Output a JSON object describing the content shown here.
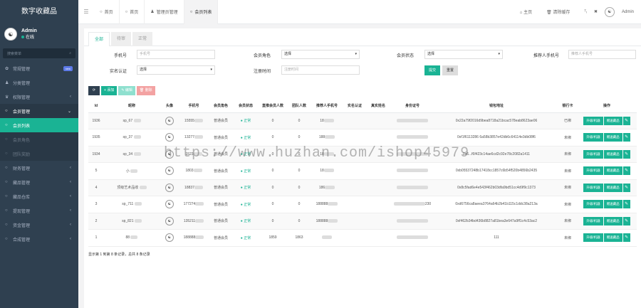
{
  "brand": "数字收藏品",
  "profile": {
    "name": "Admin",
    "status": "在线"
  },
  "sidebar": {
    "search_placeholder": "搜索菜单",
    "items": [
      {
        "icon": "dashboard-icon",
        "label": "常规管理",
        "badge": "new"
      },
      {
        "icon": "user-icon",
        "label": "分类管理"
      },
      {
        "icon": "group-icon",
        "label": "权限管理",
        "caret": "‹"
      },
      {
        "icon": "circle-icon",
        "label": "会员管理",
        "caret": "⌄",
        "open": true
      }
    ],
    "sub_items": [
      {
        "label": "会员列表",
        "active": true
      },
      {
        "label": "会员角色"
      },
      {
        "label": "团队奖励"
      }
    ],
    "items2": [
      {
        "label": "财务管理"
      },
      {
        "label": "藏品管理"
      },
      {
        "label": "藏品仓库"
      },
      {
        "label": "提现管理"
      },
      {
        "label": "资金管理"
      },
      {
        "label": "合成管理"
      }
    ]
  },
  "topbar": {
    "tabs": [
      {
        "icon": "○",
        "label": "首页"
      },
      {
        "icon": "○",
        "label": "首页"
      },
      {
        "icon": "♟",
        "label": "管理员管理"
      },
      {
        "icon": "○",
        "label": "会员列表",
        "active": true
      }
    ],
    "home": "主页",
    "clear_cache": "清除缓存",
    "user": "Admin"
  },
  "panel": {
    "tabs": [
      "全部",
      "待审",
      "正常"
    ],
    "filters": {
      "phone_label": "手机号",
      "phone_placeholder": "手机号",
      "role_label": "会员角色",
      "role_value": "选择",
      "status_label": "会员状态",
      "status_value": "选择",
      "referrer_label": "推荐人手机号",
      "referrer_placeholder": "推荐人手机号",
      "realname_label": "实名认证",
      "realname_value": "选择",
      "regtime_label": "注册时间",
      "regtime_placeholder": "注册时间",
      "submit": "提交",
      "reset": "重置"
    },
    "toolbar": {
      "refresh": "⟳",
      "add": "+ 添加",
      "edit": "✎ 编辑",
      "del": "🗑 删除"
    },
    "columns": [
      "Id",
      "昵称",
      "头像",
      "手机号",
      "会员角色",
      "会员状态",
      "直推会员人数",
      "团队人数",
      "推荐人手机号",
      "实名认证",
      "真实姓名",
      "身份证号",
      "钱包地址",
      "银行卡",
      "操作"
    ],
    "rows": [
      {
        "id": "1936",
        "nick": "sp_67",
        "phone": "15555",
        "role": "普通会员",
        "status": "● 正常",
        "direct": "0",
        "team": "0",
        "ref": "18",
        "wallet": "0x22a79f2016d9bea8718a21bcac578eab8623ae06",
        "bank": "已绑"
      },
      {
        "id": "1935",
        "nick": "sp_37",
        "phone": "13277",
        "role": "普通会员",
        "status": "● 正常",
        "direct": "0",
        "team": "0",
        "ref": "188",
        "wallet": "0xf1f6113286 6a58b3857e42db6c64114e3db08f6",
        "bank": "未绑"
      },
      {
        "id": "1934",
        "nick": "sp_34",
        "phone": "1523",
        "role": "普通会员",
        "status": "● 正常",
        "direct": "0",
        "team": "0",
        "ref": "18",
        "wallet": "0x6...f6f423c14ae6cd2c92e78c2082a1411",
        "bank": "未绑"
      },
      {
        "id": "5",
        "nick": "小",
        "phone": "1803",
        "role": "普通会员",
        "status": "● 正常",
        "direct": "0",
        "team": "0",
        "ref": "18",
        "wallet": "0xb05537248b17418cc1857c6b54f520b4856b2435",
        "bank": "未绑"
      },
      {
        "id": "4",
        "nick": "顶级艺术品收",
        "phone": "18837",
        "role": "普通会员",
        "status": "● 正常",
        "direct": "0",
        "team": "0",
        "ref": "186",
        "wallet": "0x8c5fad6e4e543f462b03dfa9bd51cc4d9f9c1373",
        "bank": "未绑"
      },
      {
        "id": "3",
        "nick": "sp_711",
        "phone": "177274",
        "role": "普通会员",
        "status": "● 正常",
        "direct": "0",
        "team": "0",
        "ref": "188888",
        "idcard": "230",
        "wallet": "0xd6756ca8aeea3764a64b2b41b115c1ddc38a213a",
        "bank": "未绑"
      },
      {
        "id": "2",
        "nick": "sp_821",
        "phone": "135211",
        "role": "普通会员",
        "status": "● 正常",
        "direct": "0",
        "team": "0",
        "ref": "188888",
        "wallet": "0xf462b34bd436b8827a81bea3e647a9ff1c4c53ac2",
        "bank": "未绑"
      },
      {
        "id": "1",
        "nick": "88",
        "phone": "188888",
        "role": "普通会员",
        "status": "● 正常",
        "direct": "1859",
        "team": "1863",
        "ref": "",
        "wallet": "111",
        "bank": "未绑"
      }
    ],
    "actions": {
      "upgrade": "升级/机器",
      "bind": "赠送藏品",
      "edit": "✎"
    },
    "footer": "显示第 1 到第 8 条记录，总共 8 条记录"
  },
  "watermark": "https://www.huzhan.com/ishop45979"
}
